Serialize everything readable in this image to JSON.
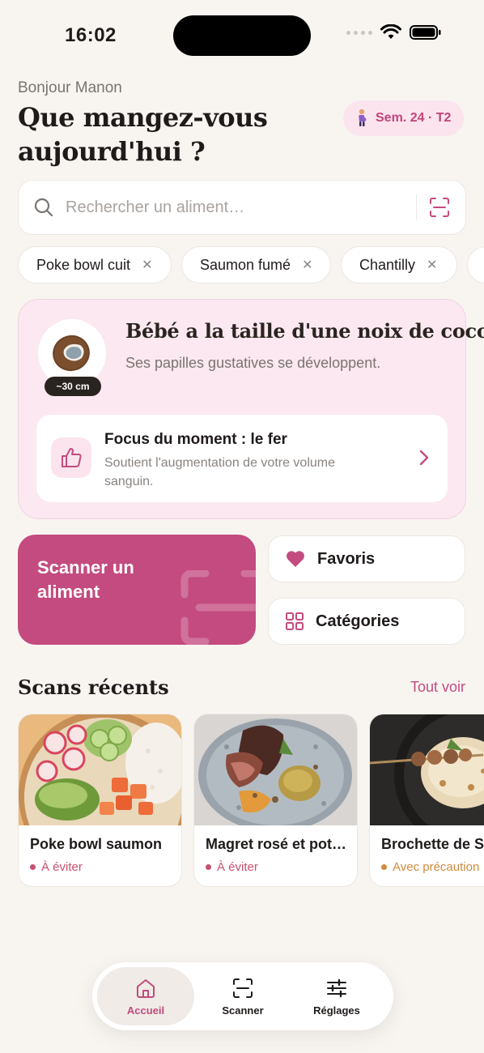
{
  "status_bar": {
    "time": "16:02"
  },
  "header": {
    "greeting": "Bonjour Manon",
    "headline": "Que mangez-vous aujourd'hui ?",
    "week_badge": "Sem. 24 · T2"
  },
  "search": {
    "placeholder": "Rechercher un aliment…",
    "value": ""
  },
  "recent_searches": [
    {
      "label": "Poke bowl cuit"
    },
    {
      "label": "Saumon fumé"
    },
    {
      "label": "Chantilly"
    },
    {
      "label": ""
    }
  ],
  "baby": {
    "title": "Bébé a la taille d'une noix de coco",
    "subtitle": "Ses papilles gustatives se développent.",
    "size": "~30 cm",
    "focus": {
      "title": "Focus du moment : le fer",
      "description": "Soutient l'augmentation de votre volume sanguin."
    }
  },
  "actions": {
    "scan": "Scanner un aliment",
    "favorites": "Favoris",
    "categories": "Catégories"
  },
  "recents": {
    "title": "Scans récents",
    "see_all": "Tout voir",
    "items": [
      {
        "name": "Poke bowl saumon",
        "status": "À éviter",
        "status_color": "#c9506f"
      },
      {
        "name": "Magret rosé et pot…",
        "status": "À éviter",
        "status_color": "#c9506f"
      },
      {
        "name": "Brochette de S",
        "status": "Avec précaution",
        "status_color": "#d28a3c"
      }
    ]
  },
  "tabbar": {
    "home": "Accueil",
    "scanner": "Scanner",
    "settings": "Réglages"
  },
  "colors": {
    "accent": "#c34b7f",
    "background": "#f8f5f1",
    "card_pink": "#fbe8f0"
  }
}
